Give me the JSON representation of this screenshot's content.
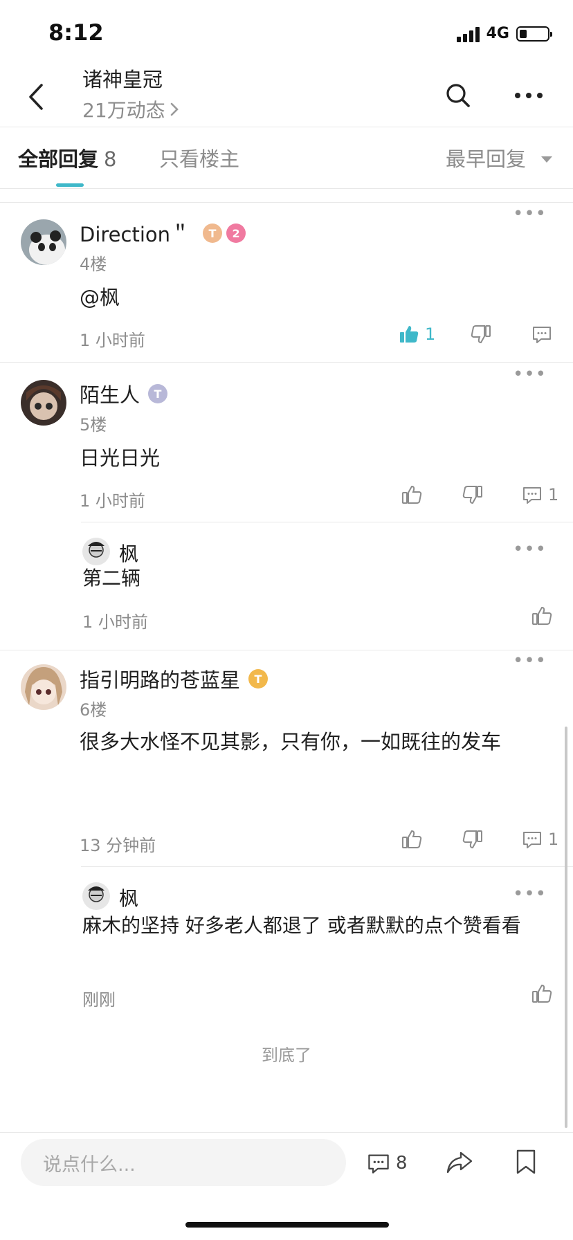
{
  "status_bar": {
    "time": "8:12",
    "network": "4G"
  },
  "header": {
    "title": "诸神皇冠",
    "subtitle": "21万动态"
  },
  "tabs": {
    "all_label": "全部回复",
    "all_count": "8",
    "owner_only": "只看楼主",
    "sort": "最早回复"
  },
  "posts": [
    {
      "name": "Direction＂",
      "level_badge": "2",
      "floor": "4楼",
      "content": "@枫",
      "time": "1 小时前",
      "like_count": "1",
      "comment_count": ""
    },
    {
      "name": "陌生人",
      "floor": "5楼",
      "content": "日光日光",
      "time": "1 小时前",
      "comment_count": "1",
      "reply": {
        "name": "枫",
        "content": "第二辆",
        "time": "1 小时前"
      }
    },
    {
      "name": "指引明路的苍蓝星",
      "floor": "6楼",
      "content": "很多大水怪不见其影，只有你，一如既往的发车",
      "time": "13 分钟前",
      "comment_count": "1",
      "reply": {
        "name": "枫",
        "content": "麻木的坚持 好多老人都退了 或者默默的点个赞看看",
        "time": "刚刚"
      }
    }
  ],
  "end_text": "到底了",
  "bottom_bar": {
    "placeholder": "说点什么...",
    "comment_count": "8"
  },
  "colors": {
    "accent": "#3fb8c9",
    "text": "#1f1f1f",
    "muted": "#8c8c8c"
  },
  "icons": [
    "back-icon",
    "search-icon",
    "more-icon",
    "thumb-up-icon",
    "thumb-down-icon",
    "comment-icon",
    "share-icon",
    "bookmark-icon"
  ]
}
